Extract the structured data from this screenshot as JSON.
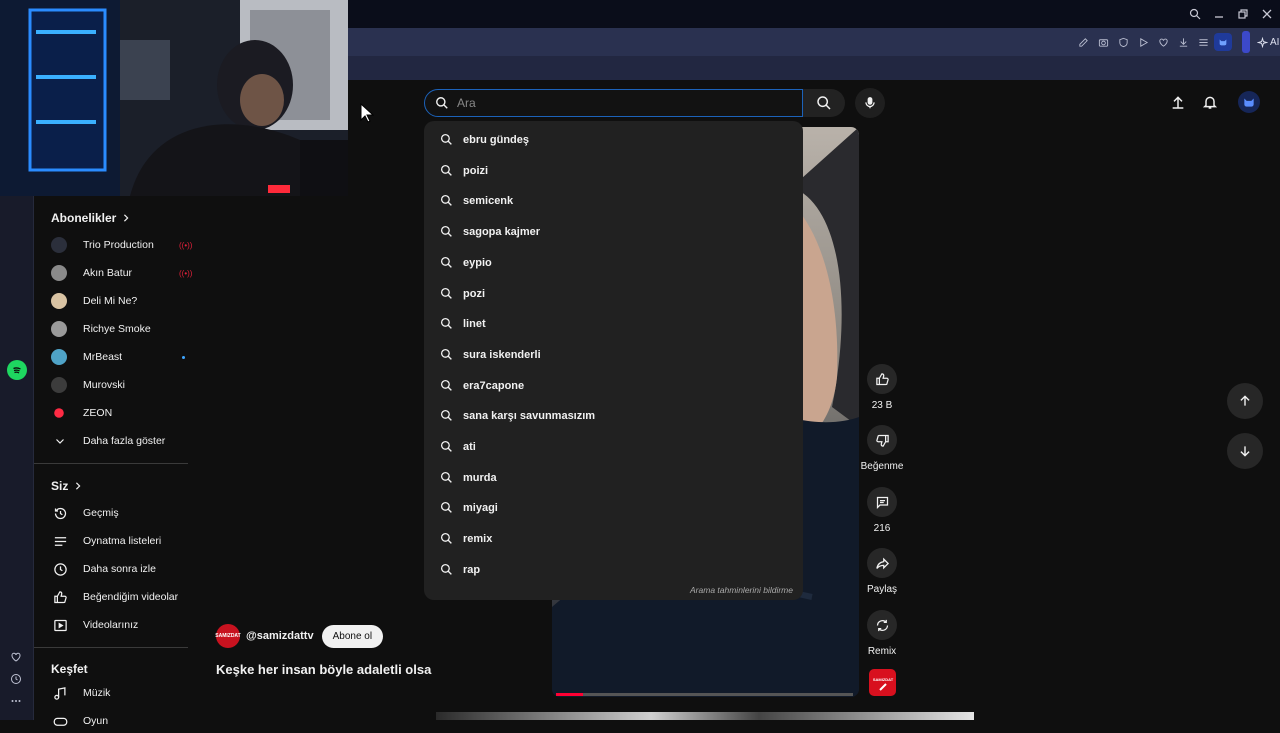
{
  "search": {
    "placeholder": "Ara",
    "value": ""
  },
  "suggestions": [
    "ebru gündeş",
    "poizi",
    "semicenk",
    "sagopa kajmer",
    "eypio",
    "pozi",
    "linet",
    "sura iskenderli",
    "era7capone",
    "sana karşı savunmasızım",
    "ati",
    "murda",
    "miyagi",
    "remix",
    "rap"
  ],
  "suggestions_report": "Arama tahminlerini bildirme",
  "browser": {
    "ai_label": "AI"
  },
  "guide": {
    "subscriptions_title": "Abonelikler",
    "subscriptions": [
      {
        "label": "Trio Production",
        "badge": "live",
        "color": "#2b2f3b"
      },
      {
        "label": "Akın Batur",
        "badge": "live",
        "color": "#8a8a8a"
      },
      {
        "label": "Deli Mi Ne?",
        "badge": "",
        "color": "#d9c3a3"
      },
      {
        "label": "Richye Smoke",
        "badge": "",
        "color": "#9a9a9a"
      },
      {
        "label": "MrBeast",
        "badge": "dot",
        "color": "#4fa3c7"
      },
      {
        "label": "Murovski",
        "badge": "",
        "color": "#3c3c3c"
      },
      {
        "label": "ZEON",
        "badge": "",
        "color": "#ff2b44"
      }
    ],
    "show_more": "Daha fazla göster",
    "you_title": "Siz",
    "you_items": [
      {
        "label": "Geçmiş",
        "icon": "history-icon"
      },
      {
        "label": "Oynatma listeleri",
        "icon": "playlist-icon"
      },
      {
        "label": "Daha sonra izle",
        "icon": "clock-icon"
      },
      {
        "label": "Beğendiğim videolar",
        "icon": "thumb-up-icon"
      },
      {
        "label": "Videolarınız",
        "icon": "video-icon"
      }
    ],
    "explore_title": "Keşfet",
    "explore_items": [
      {
        "label": "Müzik",
        "icon": "music-note-icon"
      },
      {
        "label": "Oyun",
        "icon": "gamepad-icon"
      }
    ]
  },
  "actions": {
    "like_count": "23 B",
    "dislike_label": "Beğenme",
    "comments_count": "216",
    "share_label": "Paylaş",
    "remix_label": "Remix"
  },
  "video": {
    "channel_handle": "@samizdattv",
    "channel_avatar_text": "SAMIZDAT",
    "subscribe_label": "Abone ol",
    "title": "Keşke her insan böyle adaletli olsa",
    "progress": 0.09
  },
  "colors": {
    "accent": "#1c62b9",
    "brand_red": "#ff0033",
    "bg": "#0f0f0f"
  }
}
